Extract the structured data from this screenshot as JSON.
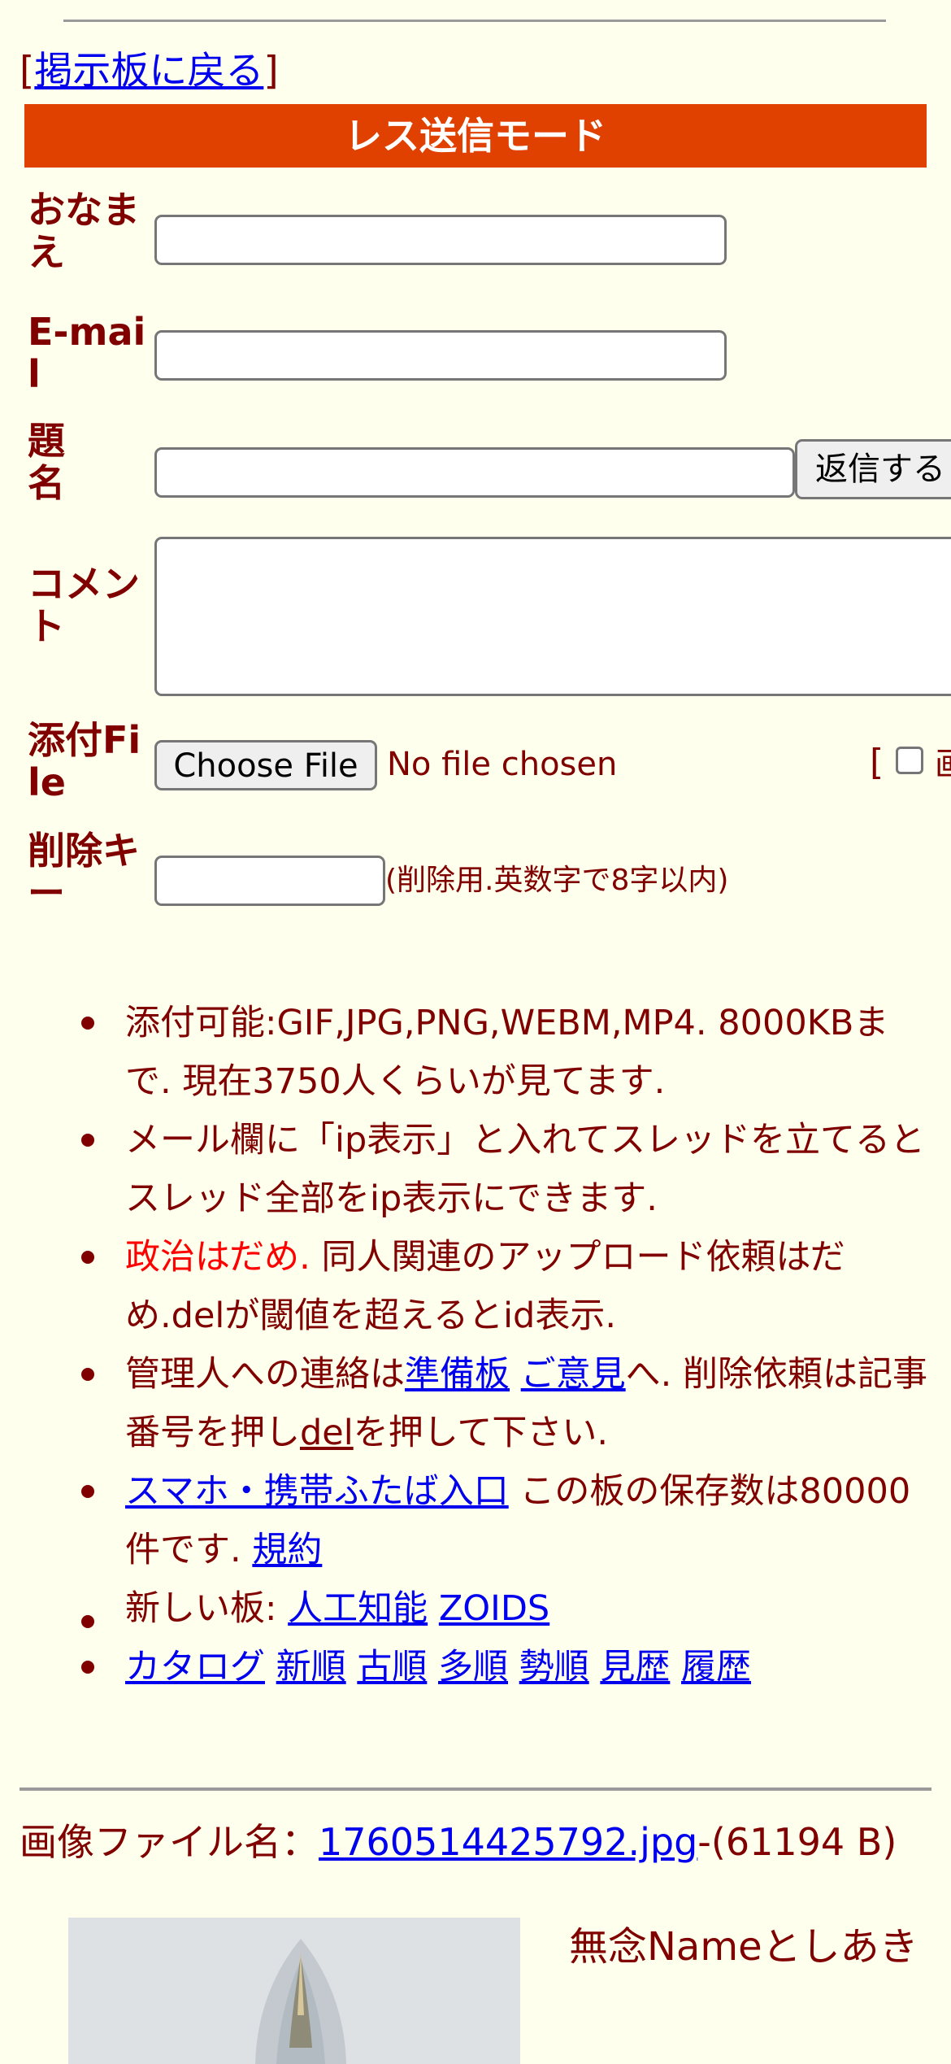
{
  "nav": {
    "open": "[",
    "back_link": "掲示板に戻る",
    "close": "]"
  },
  "form": {
    "banner": "レス送信モード",
    "name_label": "おなまえ",
    "email_label": "E-mail",
    "subject_label": "題名",
    "comment_label": "コメント",
    "file_label": "添付File",
    "delkey_label": "削除キー",
    "submit_button": "返信する",
    "choose_file_button": "Choose File",
    "no_file_text": "No file chosen",
    "extra_bracket": "[",
    "extra_label_fragment": "画",
    "delkey_note": "(削除用.英数字で8字以内)"
  },
  "rules": {
    "r1": "添付可能:GIF,JPG,PNG,WEBM,MP4. 8000KBまで. 現在3750人くらいが見てます.",
    "r2": "メール欄に「ip表示」と入れてスレッドを立てるとスレッド全部をip表示にできます.",
    "r3_red": "政治はだめ.",
    "r3_rest": " 同人関連のアップロード依頼はだめ.delが閾値を超えるとid表示.",
    "r4_a": "管理人への連絡は",
    "r4_link1": "準備板",
    "r4_space": " ",
    "r4_link2": "ご意見",
    "r4_b": "へ. 削除依頼は記事番号を押し",
    "r4_link3": "del",
    "r4_c": "を押して下さい.",
    "r5_link": "スマホ・携帯ふたば入口",
    "r5_text": " この板の保存数は80000件です. ",
    "r5_link2": "規約",
    "r6_label": "新しい板: ",
    "r6_link1": "人工知能",
    "r6_link2": "ZOIDS",
    "sort_links": [
      "カタログ",
      "新順",
      "古順",
      "多順",
      "勢順",
      "見歴",
      "履歴"
    ]
  },
  "post": {
    "file_label": "画像ファイル名：",
    "file_link": "1760514425792.jpg",
    "file_size": "-(61194 B)",
    "name_line": "無念Nameとしあき"
  }
}
